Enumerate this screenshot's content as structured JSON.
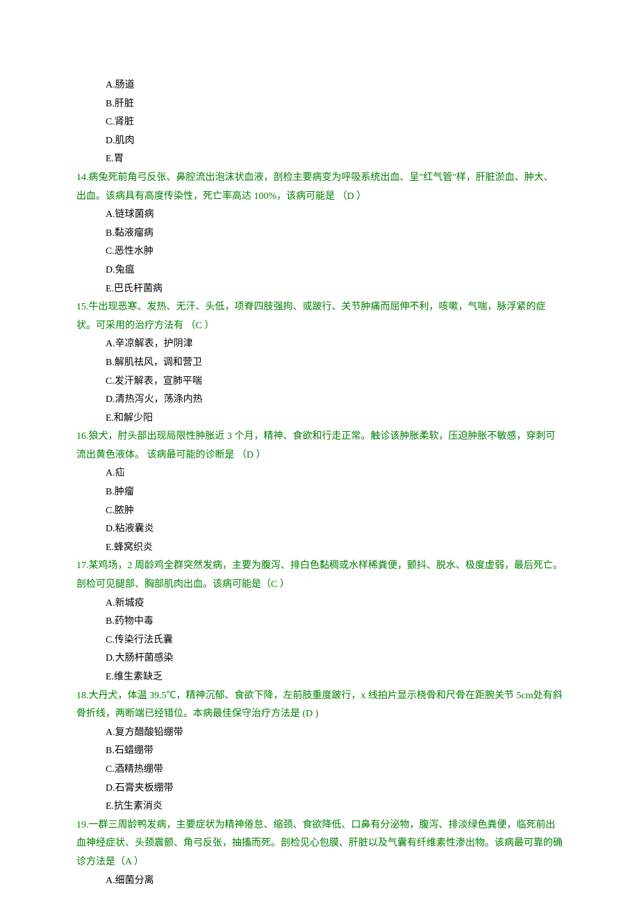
{
  "q13_options": {
    "a": "A.肠道",
    "b": "B.肝脏",
    "c": "C.肾脏",
    "d": "D.肌肉",
    "e": "E.胃"
  },
  "q14": {
    "text": "14.病兔死前角弓反张、鼻腔流出泡沫状血液，剖检主要病变为呼吸系统出血、呈\"红气管\"样，肝脏淤血、肿大、出血。该病具有高度传染性，死亡率高达 100%，该病可能是 （D ）",
    "a": "A.链球菌病",
    "b": "B.黏液瘤病",
    "c": "C.恶性水肿",
    "d": "D.兔瘟",
    "e": "E.巴氏杆菌病"
  },
  "q15": {
    "text": "15.牛出现恶寒、发热、无汗、头低，项脊四肢强拘、或跛行、关节肿痛而屈伸不利，咳嗽，气喘，脉浮紧的症状。可采用的治疗方法有 （C ）",
    "a": "A.辛凉解表，护阴津",
    "b": "B.解肌祛风，调和营卫",
    "c": "C.发汗解表，宣肺平喘",
    "d": "D.清热泻火，荡涤内热",
    "e": "E.和解少阳"
  },
  "q16": {
    "text": "16.狼犬，肘头部出现局限性肿胀近 3 个月，精神、食欲和行走正常。触诊该肿胀柔软，压迫肿胀不敏感，穿刺可流出黄色液体。 该病最可能的诊断是 （D ）",
    "a": "A.疝",
    "b": "B.肿瘤",
    "c": "C.脓肿",
    "d": "D.粘液囊炎",
    "e": "E.蜂窝织炎"
  },
  "q17": {
    "text": "17.某鸡场，2 周龄鸡全群突然发病，主要为腹泻、排白色黏稠或水样稀粪便，颤抖、脱水、极度虚弱，最后死亡。剖检可见腿部、胸部肌肉出血。该病可能是（C ）",
    "a": "A.新城疫",
    "b": "B.药物中毒",
    "c": "C.传染行法氏囊",
    "d": "D.大肠杆菌感染",
    "e": "E.维生素缺乏"
  },
  "q18": {
    "text": "18.大丹犬，体温 39.5℃，精神沉郁、食欲下降，左前肢重度跛行，x 线拍片显示桡骨和尺骨在距腕关节 5cm处有斜骨折线，两断端已经错位。本病最佳保守治疗方法是 (D )",
    "a": "A.复方醋酸铅绷带",
    "b": "B.石蜡绷带",
    "c": "C.酒精热绷带",
    "d": "D.石膏夹板绷带",
    "e": "E.抗生素消炎"
  },
  "q19": {
    "text": "19.一群三周龄鸭发病，主要症状为精神倦怠、缩颈、食欲降低、口鼻有分泌物，腹泻、排淡绿色粪便，临死前出血神经症状、头颈震颤、角弓反张，抽搐而死。剖检见心包膜、肝脏以及气囊有纤维素性渗出物。该病最可靠的确诊方法是（A ）",
    "a": "A.细菌分离"
  }
}
